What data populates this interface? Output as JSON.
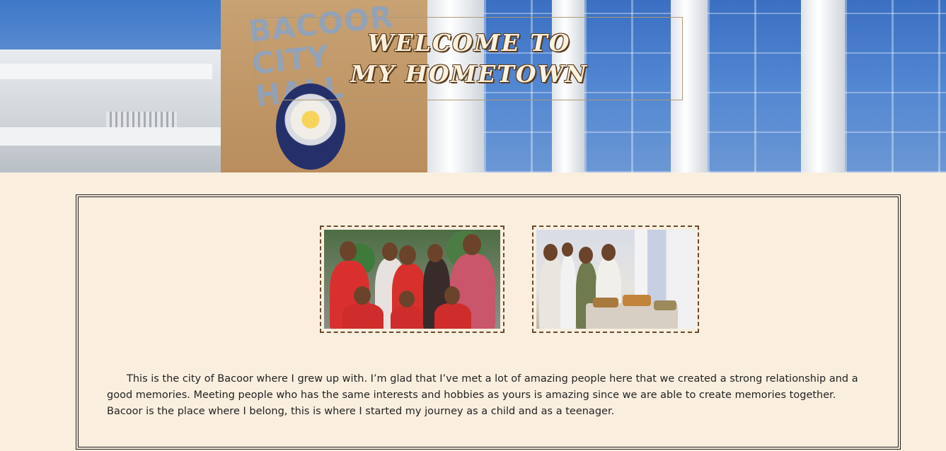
{
  "hero": {
    "title": "Welcome to my hometown",
    "wall_sign": "BACOOR CITY HALL"
  },
  "photos": [
    {
      "name": "group-photo-red-shirts"
    },
    {
      "name": "group-photo-food-table"
    }
  ],
  "content": {
    "paragraph": "This is the city of Bacoor where I grew up with. I’m glad that I’ve met a lot of amazing people here that we created a strong relationship and a good memories. Meeting people who has the same interests and hobbies as yours is amazing since we are able to create memories together. Bacoor is the place where I belong, this is where I started my journey as a child and as a teenager."
  },
  "colors": {
    "background": "#faefdf",
    "title_text": "#fbf1de",
    "photo_border": "#6b4a2e",
    "content_border": "#1c1c1c"
  }
}
